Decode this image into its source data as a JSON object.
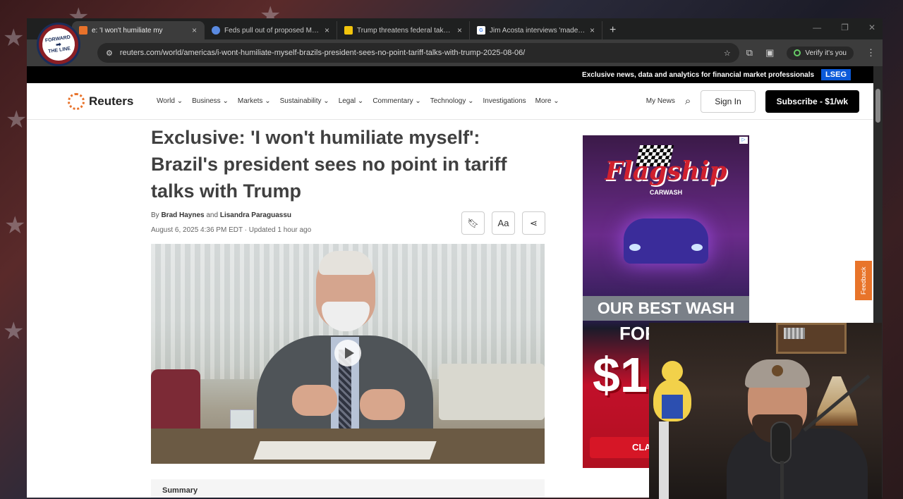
{
  "browser": {
    "tabs": [
      {
        "title": "e: 'I won't humiliate my",
        "favicon": "reuters-icon",
        "active": true
      },
      {
        "title": "Feds pull out of proposed MAG",
        "favicon": "globe-icon",
        "active": false
      },
      {
        "title": "Trump threatens federal takeov",
        "favicon": "news-icon",
        "active": false
      },
      {
        "title": "Jim Acosta interviews 'made-up",
        "favicon": "google-icon",
        "active": false
      }
    ],
    "url": "reuters.com/world/americas/i-wont-humiliate-myself-brazils-president-sees-no-point-tariff-talks-with-trump-2025-08-06/",
    "verify_label": "Verify it's you"
  },
  "overlay_logo": {
    "line1": "FORWARD",
    "line2": "THE LINE"
  },
  "site": {
    "topbar_text": "Exclusive news, data and analytics for financial market professionals",
    "topbar_brand": "LSEG",
    "brand": "Reuters",
    "nav": [
      "World",
      "Business",
      "Markets",
      "Sustainability",
      "Legal",
      "Commentary",
      "Technology",
      "Investigations",
      "More"
    ],
    "nav_has_dropdown": [
      true,
      true,
      true,
      true,
      true,
      true,
      true,
      false,
      true
    ],
    "my_news": "My News",
    "sign_in": "Sign In",
    "subscribe": "Subscribe - $1/wk"
  },
  "article": {
    "headline": "Exclusive: 'I won't humiliate myself': Brazil's president sees no point in tariff talks with Trump",
    "by": "By",
    "author1": "Brad Haynes",
    "and": "and",
    "author2": "Lisandra Paraguassu",
    "dateline": "August 6, 2025 4:36 PM EDT · Updated 1 hour ago",
    "text_size_label": "Aa",
    "summary_label": "Summary"
  },
  "ad": {
    "brand": "Flagship",
    "sub": "CARWASH",
    "headline": "OUR BEST WASH",
    "for": "FOR",
    "price": "$1",
    "cta": "CLA"
  },
  "feedback": "Feedback",
  "colors": {
    "accent": "#e8722a",
    "lseg": "#0b5ad9",
    "ad_red": "#d0202e"
  }
}
